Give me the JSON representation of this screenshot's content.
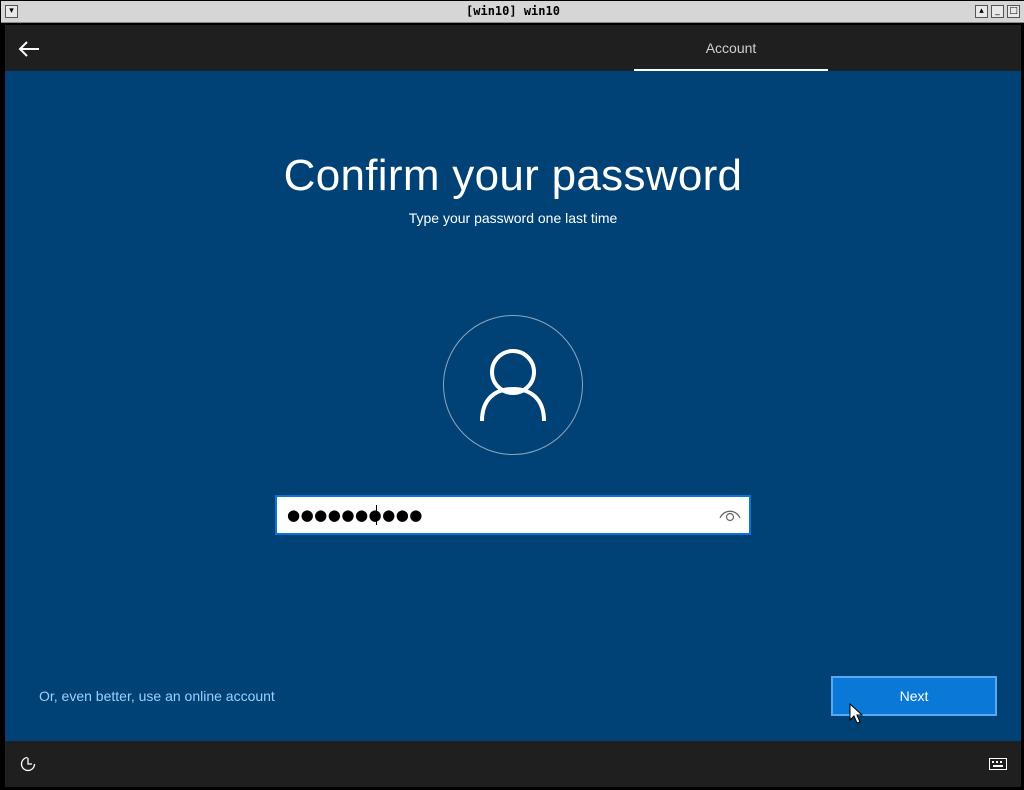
{
  "window": {
    "title": "[win10] win10"
  },
  "topbar": {
    "tab_label": "Account"
  },
  "main": {
    "heading": "Confirm your password",
    "subheading": "Type your password one last time",
    "password": {
      "masked_value": "●●●●●●●●●●",
      "length": 10
    }
  },
  "footer": {
    "online_link": "Or, even better, use an online account",
    "next_label": "Next"
  },
  "colors": {
    "background": "#004275",
    "bars": "#1f1f1f",
    "accent": "#0a78d7",
    "link": "#9ad0ff"
  },
  "icons": {
    "back": "back-arrow-icon",
    "avatar": "user-icon",
    "reveal": "eye-icon",
    "ease_of_access": "ease-of-access-icon",
    "keyboard": "keyboard-icon"
  }
}
